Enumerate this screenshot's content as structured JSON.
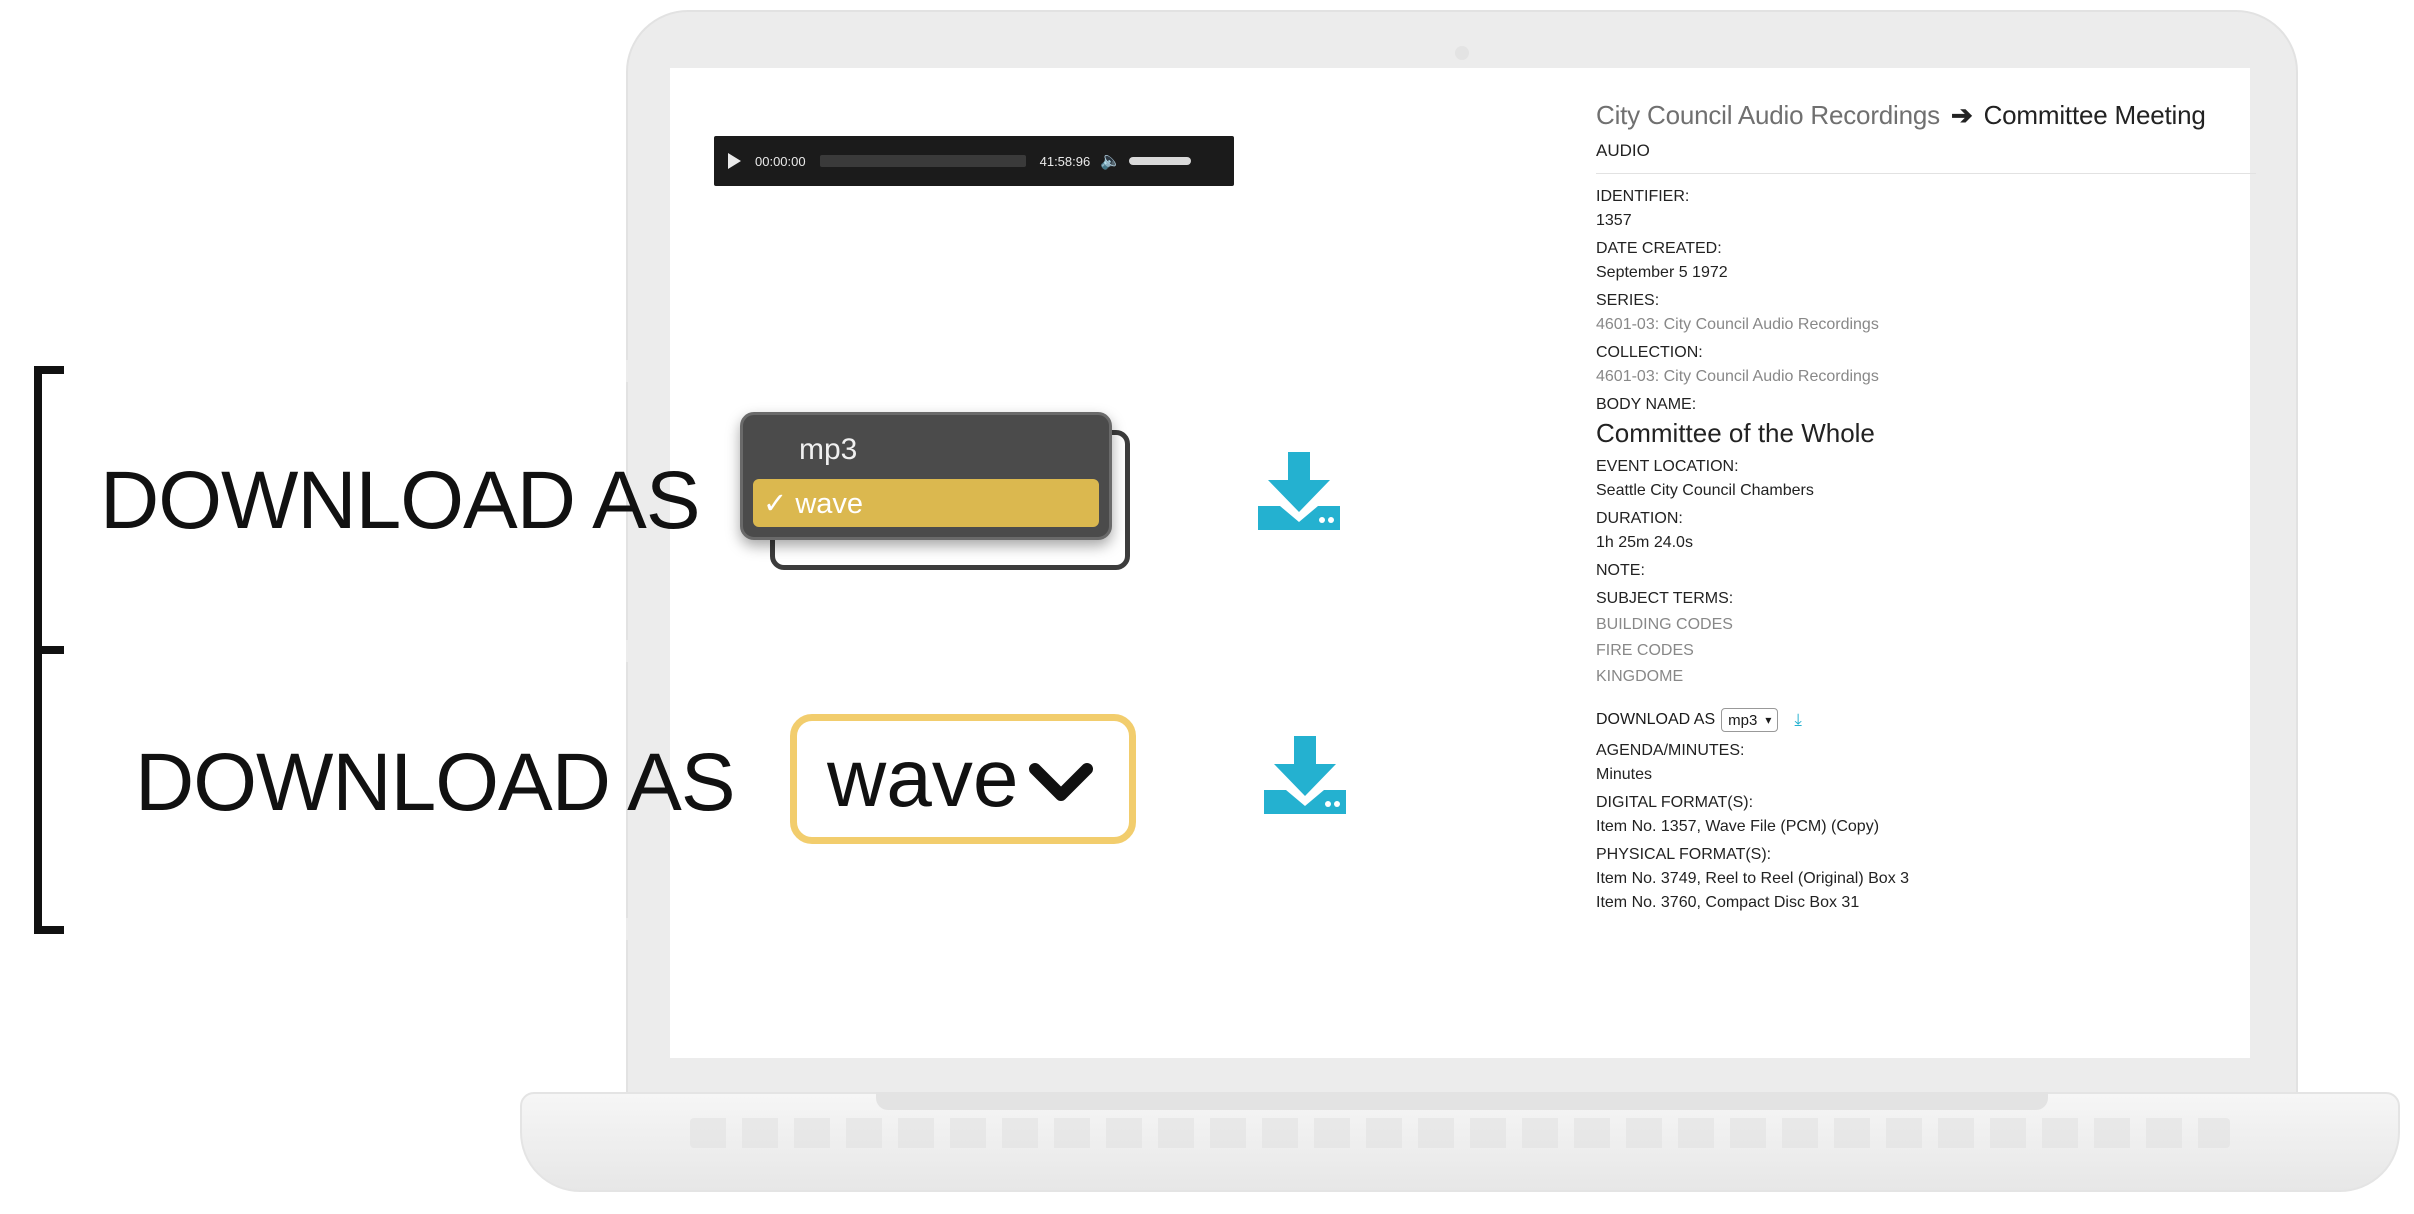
{
  "audio_player": {
    "current_time": "00:00:00",
    "total_time": "41:58:96",
    "play_icon": "play-icon",
    "volume_icon": "speaker-icon"
  },
  "record": {
    "breadcrumb": {
      "parent": "City Council Audio Recordings",
      "separator": "➔",
      "current": "Committee Meeting"
    },
    "type": "AUDIO",
    "fields": {
      "identifier": {
        "label": "IDENTIFIER:",
        "value": "1357"
      },
      "date_created": {
        "label": "DATE CREATED:",
        "value": "September 5 1972"
      },
      "series": {
        "label": "SERIES:",
        "value": "4601-03: City Council Audio Recordings"
      },
      "collection": {
        "label": "COLLECTION:",
        "value": "4601-03: City Council Audio Recordings"
      },
      "body_name": {
        "label": "BODY NAME:",
        "value": "Committee of the Whole"
      },
      "event_location": {
        "label": "EVENT LOCATION:",
        "value": "Seattle City Council Chambers"
      },
      "duration": {
        "label": "DURATION:",
        "value": "1h 25m 24.0s"
      },
      "note": {
        "label": "NOTE:"
      },
      "subject_terms": {
        "label": "SUBJECT TERMS:",
        "items": [
          "BUILDING CODES",
          "FIRE CODES",
          "KINGDOME"
        ]
      },
      "download": {
        "label": "DOWNLOAD AS",
        "selected": "mp3"
      },
      "agenda_minutes": {
        "label": "AGENDA/MINUTES:",
        "value": "Minutes"
      },
      "digital_formats": {
        "label": "DIGITAL FORMAT(S):",
        "value": "Item No. 1357, Wave File (PCM) (Copy)"
      },
      "physical_formats": {
        "label": "PHYSICAL FORMAT(S):",
        "items": [
          "Item No. 3749, Reel to Reel (Original) Box 3",
          "Item No. 3760, Compact Disc Box 31"
        ]
      }
    }
  },
  "callout": {
    "label": "DOWNLOAD AS",
    "dropdown_options": [
      "mp3",
      "wave"
    ],
    "dropdown_checked": "✓ wave",
    "select_value": "wave",
    "accent_color": "#dbb84f",
    "outline_color": "#f2cd6d",
    "download_icon_color": "#24b1d0"
  }
}
